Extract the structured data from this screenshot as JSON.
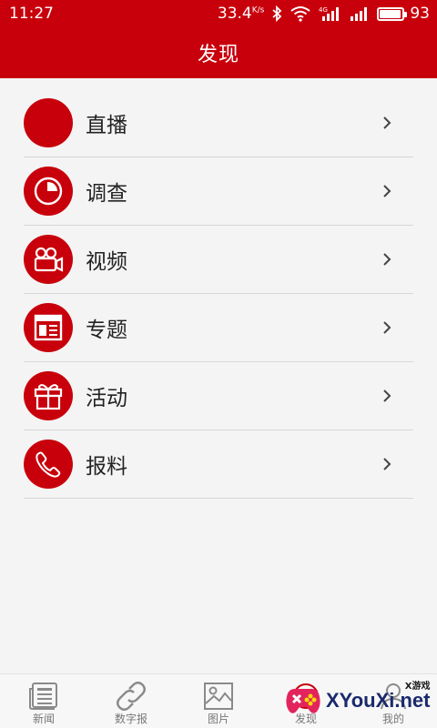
{
  "status_bar": {
    "time": "11:27",
    "net_speed": "33.4",
    "net_unit": "K/s",
    "battery": "93",
    "battery_level": 0.93
  },
  "header": {
    "title": "发现"
  },
  "menu": {
    "items": [
      {
        "label": "直播",
        "icon": "live-icon"
      },
      {
        "label": "调查",
        "icon": "pie-chart-icon"
      },
      {
        "label": "视频",
        "icon": "video-camera-icon"
      },
      {
        "label": "专题",
        "icon": "newspaper-icon"
      },
      {
        "label": "活动",
        "icon": "gift-icon"
      },
      {
        "label": "报料",
        "icon": "phone-icon"
      }
    ]
  },
  "tabs": [
    {
      "label": "新闻",
      "icon": "news-icon"
    },
    {
      "label": "数字报",
      "icon": "link-icon"
    },
    {
      "label": "图片",
      "icon": "image-icon"
    },
    {
      "label": "发现",
      "icon": "discover-icon"
    },
    {
      "label": "我的",
      "icon": "user-icon"
    }
  ],
  "watermark": {
    "small": "X游戏",
    "main": "XYouXi.net"
  },
  "colors": {
    "brand": "#c8000b",
    "background": "#f4f4f4",
    "divider": "#d7d7d7"
  }
}
